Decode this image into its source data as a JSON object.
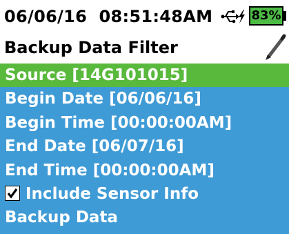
{
  "status": {
    "date": "06/06/16",
    "time": "08:51:48AM",
    "usb_icon": "usb-icon",
    "charging_icon": "lightning-icon",
    "battery_percent": "83%",
    "battery_level": 0.83,
    "battery_color": "#4dbb46"
  },
  "header": {
    "title": "Backup Data Filter",
    "edit_icon": "pen-icon"
  },
  "colors": {
    "background": "#3f9bd6",
    "selected": "#59b93c",
    "text": "#ffffff"
  },
  "menu": {
    "items": [
      {
        "label": "Source [14G101015]",
        "selected": true
      },
      {
        "label": "Begin Date [06/06/16]",
        "selected": false
      },
      {
        "label": "Begin Time [00:00:00AM]",
        "selected": false
      },
      {
        "label": "End Date [06/07/16]",
        "selected": false
      },
      {
        "label": "End Time [00:00:00AM]",
        "selected": false
      },
      {
        "label": "Include Sensor Info",
        "checked": true,
        "selected": false
      },
      {
        "label": "Backup Data",
        "selected": false
      }
    ]
  }
}
